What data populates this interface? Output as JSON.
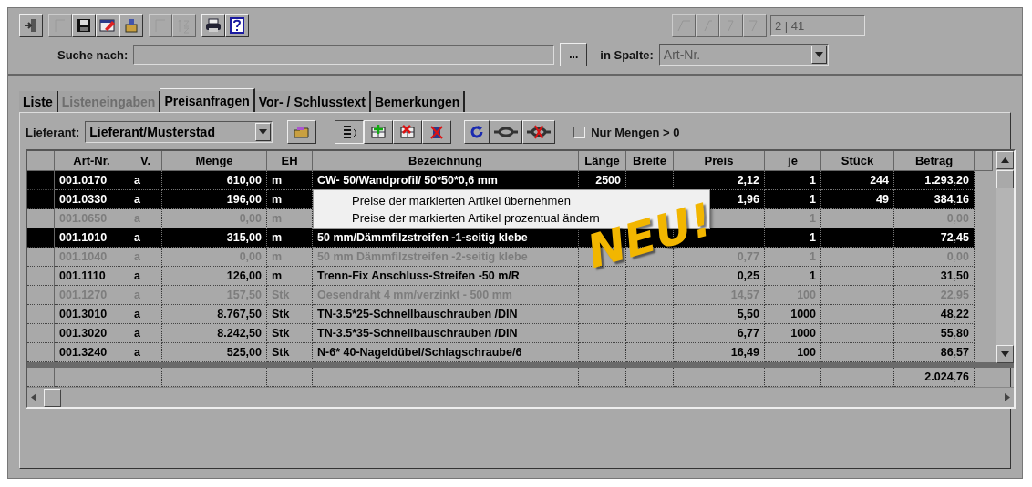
{
  "toolbar": {
    "groups": [
      [
        {
          "disabled": false
        }
      ],
      [
        {
          "disabled": true
        },
        {
          "disabled": false
        },
        {
          "disabled": false
        },
        {
          "disabled": false
        }
      ],
      [
        {
          "disabled": true
        },
        {
          "disabled": true
        }
      ],
      [
        {
          "disabled": false
        },
        {
          "disabled": false
        }
      ]
    ]
  },
  "navigator": {
    "buttons": [
      {
        "disabled": true
      },
      {
        "disabled": true
      },
      {
        "disabled": true
      },
      {
        "disabled": true
      }
    ],
    "record": "2 | 41"
  },
  "search": {
    "label": "Suche nach:",
    "browse": "...",
    "column_label": "in Spalte:",
    "column_value": "Art-Nr.",
    "column_disabled": true
  },
  "tabs": [
    {
      "label": "Liste",
      "selected": false,
      "disabled": false
    },
    {
      "label": "Listeneingaben",
      "selected": false,
      "disabled": true
    },
    {
      "label": "Preisanfragen",
      "selected": true,
      "disabled": false
    },
    {
      "label": "Vor- / Schlusstext",
      "selected": false,
      "disabled": false
    },
    {
      "label": "Bemerkungen",
      "selected": false,
      "disabled": false
    }
  ],
  "supplier": {
    "label": "Lieferant:",
    "value": "Lieferant/Musterstad"
  },
  "tools": [
    {
      "pressed": false
    },
    {
      "pressed": true
    },
    {
      "pressed": false
    },
    {
      "pressed": false
    },
    {
      "pressed": false
    },
    {
      "pressed": false
    },
    {
      "pressed": false
    },
    {
      "pressed": false
    }
  ],
  "filter": {
    "label": "Nur Mengen > 0",
    "checked": false
  },
  "table": {
    "columns": [
      "Art-Nr.",
      "V.",
      "Menge",
      "EH",
      "Bezeichnung",
      "Länge",
      "Breite",
      "Preis",
      "je",
      "Stück",
      "Betrag"
    ],
    "rows": [
      {
        "selected": true,
        "dimmed": false,
        "cells": [
          "001.0170",
          "a",
          "610,00",
          "m",
          "CW- 50/Wandprofil/ 50*50*0,6 mm",
          "2500",
          null,
          "2,12",
          "1",
          "244",
          "1.293,20"
        ]
      },
      {
        "selected": true,
        "dimmed": false,
        "cells": [
          "001.0330",
          "a",
          "196,00",
          "m",
          null,
          null,
          null,
          "1,96",
          "1",
          "49",
          "384,16"
        ]
      },
      {
        "selected": false,
        "dimmed": true,
        "cells": [
          "001.0650",
          "a",
          "0,00",
          "m",
          null,
          null,
          null,
          null,
          "1",
          null,
          "0,00"
        ]
      },
      {
        "selected": true,
        "dimmed": false,
        "cells": [
          "001.1010",
          "a",
          "315,00",
          "m",
          "50 mm/Dämmfilzstreifen  -1-seitig klebe",
          null,
          null,
          null,
          "1",
          null,
          "72,45"
        ]
      },
      {
        "selected": false,
        "dimmed": true,
        "cells": [
          "001.1040",
          "a",
          "0,00",
          "m",
          "50 mm Dämmfilzstreifen  -2-seitig klebe",
          null,
          null,
          "0,77",
          "1",
          null,
          "0,00"
        ]
      },
      {
        "selected": false,
        "dimmed": false,
        "cells": [
          "001.1110",
          "a",
          "126,00",
          "m",
          "Trenn-Fix Anschluss-Streifen   -50 m/R",
          null,
          null,
          "0,25",
          "1",
          null,
          "31,50"
        ]
      },
      {
        "selected": false,
        "dimmed": true,
        "cells": [
          "001.1270",
          "a",
          "157,50",
          "Stk",
          "Oesendraht 4 mm/verzinkt    - 500 mm",
          null,
          null,
          "14,57",
          "100",
          null,
          "22,95"
        ]
      },
      {
        "selected": false,
        "dimmed": false,
        "cells": [
          "001.3010",
          "a",
          "8.767,50",
          "Stk",
          "TN-3.5*25-Schnellbauschrauben  /DIN",
          null,
          null,
          "5,50",
          "1000",
          null,
          "48,22"
        ]
      },
      {
        "selected": false,
        "dimmed": false,
        "cells": [
          "001.3020",
          "a",
          "8.242,50",
          "Stk",
          "TN-3.5*35-Schnellbauschrauben  /DIN",
          null,
          null,
          "6,77",
          "1000",
          null,
          "55,80"
        ]
      },
      {
        "selected": false,
        "dimmed": false,
        "cells": [
          "001.3240",
          "a",
          "525,00",
          "Stk",
          "N-6* 40-Nageldübel/Schlagschraube/6",
          null,
          null,
          "16,49",
          "100",
          null,
          "86,57"
        ]
      }
    ],
    "total": "2.024,76"
  },
  "context_menu": [
    "Preise der markierten Artikel übernehmen",
    "Preise der markierten Artikel prozentual ändern"
  ],
  "stamp": "NEU!"
}
